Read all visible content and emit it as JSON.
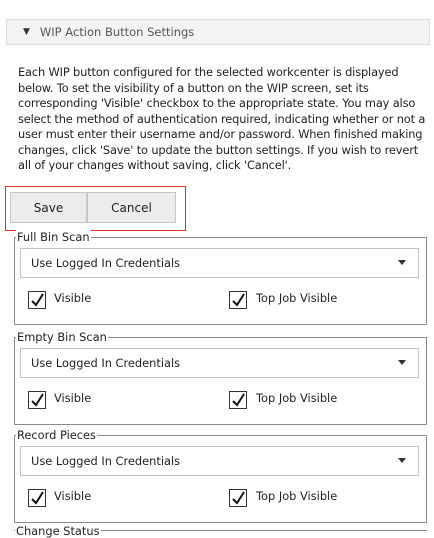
{
  "header": {
    "title": "WIP Action Button Settings",
    "caret_icon": "caret-down-icon"
  },
  "description": "Each WIP button configured for the selected workcenter is displayed below. To set the visibility of a button on the WIP screen, set its corresponding 'Visible' checkbox to the appropriate state. You may also select the method of authentication required, indicating whether or not a user must enter their username and/or password. When finished making changes, click 'Save' to update the button settings. If you wish to revert all of your changes without saving, click 'Cancel'.",
  "actions": {
    "save_label": "Save",
    "cancel_label": "Cancel",
    "highlight_color": "#d9312b"
  },
  "groups": [
    {
      "legend": "Full Bin Scan",
      "auth": "Use Logged In Credentials",
      "visible_label": "Visible",
      "visible": true,
      "topjob_label": "Top Job Visible",
      "topjob": true
    },
    {
      "legend": "Empty Bin Scan",
      "auth": "Use Logged In Credentials",
      "visible_label": "Visible",
      "visible": true,
      "topjob_label": "Top Job Visible",
      "topjob": true
    },
    {
      "legend": "Record Pieces",
      "auth": "Use Logged In Credentials",
      "visible_label": "Visible",
      "visible": true,
      "topjob_label": "Top Job Visible",
      "topjob": true
    }
  ],
  "partial_group_legend": "Change Status"
}
